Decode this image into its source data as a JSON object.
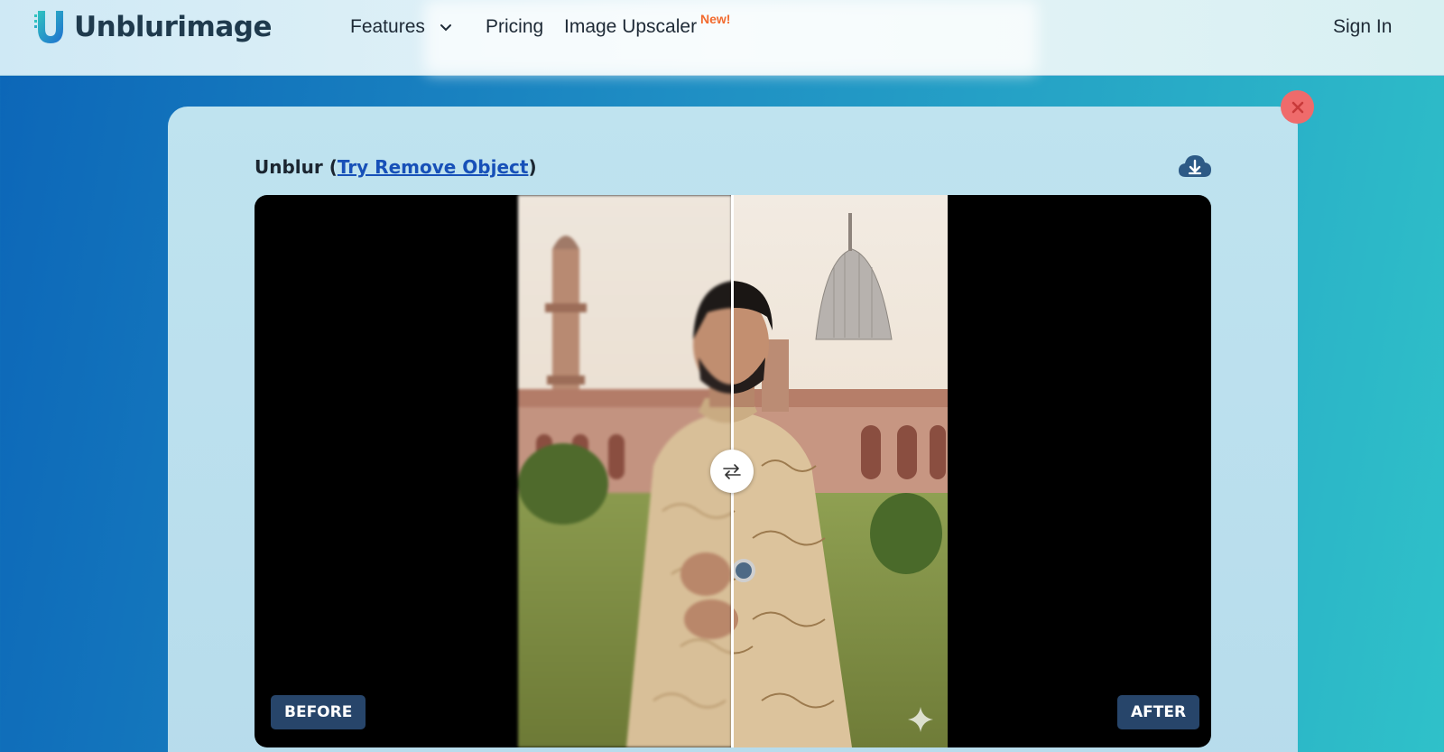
{
  "navbar": {
    "brand": "Unblurimage",
    "items": [
      {
        "label": "Features"
      },
      {
        "label": "Pricing"
      },
      {
        "label": "Image Upscaler"
      }
    ],
    "new_tag": "New!",
    "sign_in": "Sign In"
  },
  "editor": {
    "title_prefix": "Unblur (",
    "title_link": "Try Remove Object",
    "title_suffix": ")",
    "before_label": "BEFORE",
    "after_label": "AFTER",
    "slider_position": 0.5
  },
  "colors": {
    "close": "#ef6b6b",
    "badge": "#27456a",
    "link": "#1750b8",
    "new_tag": "#f26a2e"
  },
  "icons": {
    "close": "close-icon",
    "download": "cloud-download-icon",
    "swap": "swap-arrows-icon",
    "features_chevron": "chevron-down-icon",
    "sparkle": "sparkle-icon"
  }
}
